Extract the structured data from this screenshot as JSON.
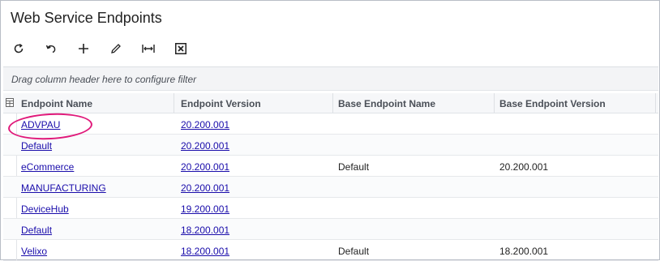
{
  "page": {
    "title": "Web Service Endpoints"
  },
  "toolbar": [
    {
      "name": "refresh-button",
      "icon": "refresh-icon"
    },
    {
      "name": "undo-button",
      "icon": "undo-icon"
    },
    {
      "name": "add-button",
      "icon": "plus-icon"
    },
    {
      "name": "edit-button",
      "icon": "pencil-icon"
    },
    {
      "name": "fit-width-button",
      "icon": "fit-width-icon"
    },
    {
      "name": "export-excel-button",
      "icon": "excel-icon"
    }
  ],
  "filter": {
    "placeholder": "Drag column header here to configure filter"
  },
  "table": {
    "columns": [
      "Endpoint Name",
      "Endpoint Version",
      "Base Endpoint Name",
      "Base Endpoint Version"
    ],
    "rows": [
      [
        "ADVPAU",
        "20.200.001",
        "",
        ""
      ],
      [
        "Default",
        "20.200.001",
        "",
        ""
      ],
      [
        "eCommerce",
        "20.200.001",
        "Default",
        "20.200.001"
      ],
      [
        "MANUFACTURING",
        "20.200.001",
        "",
        ""
      ],
      [
        "DeviceHub",
        "19.200.001",
        "",
        ""
      ],
      [
        "Default",
        "18.200.001",
        "",
        ""
      ],
      [
        "Velixo",
        "18.200.001",
        "Default",
        "18.200.001"
      ]
    ]
  },
  "annotation": {
    "color": "#e0197a",
    "target": "ADVPAU"
  }
}
